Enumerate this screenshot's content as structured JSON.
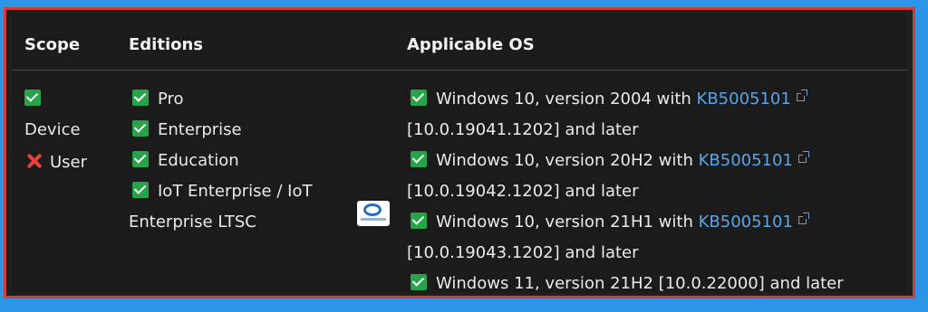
{
  "headers": {
    "scope": "Scope",
    "editions": "Editions",
    "os": "Applicable OS"
  },
  "scope": {
    "device": "Device",
    "user": "User"
  },
  "editions": {
    "items": [
      "Pro",
      "Enterprise",
      "Education",
      "IoT Enterprise / IoT"
    ],
    "continuation": "Enterprise LTSC"
  },
  "os": {
    "row1": {
      "text": "Windows 10, version 2004 with ",
      "link": "KB5005101",
      "build": "[10.0.19041.1202] and later"
    },
    "row2": {
      "text": "Windows 10, version 20H2 with ",
      "link": "KB5005101",
      "build": "[10.0.19042.1202] and later"
    },
    "row3": {
      "text": "Windows 10, version 21H1 with ",
      "link": "KB5005101",
      "build": "[10.0.19043.1202] and later"
    },
    "row4": {
      "text": "Windows 11, version 21H2 [10.0.22000] and later"
    }
  },
  "colors": {
    "check": "#27a34a",
    "cross": "#e8413c",
    "link": "#5aa5ea",
    "frame": "#d23b3b",
    "page": "#2b94e6"
  },
  "icons": {
    "check": "checkbox-checked-icon",
    "cross": "cross-icon",
    "external": "external-link-icon",
    "logo": "watermark-logo"
  }
}
